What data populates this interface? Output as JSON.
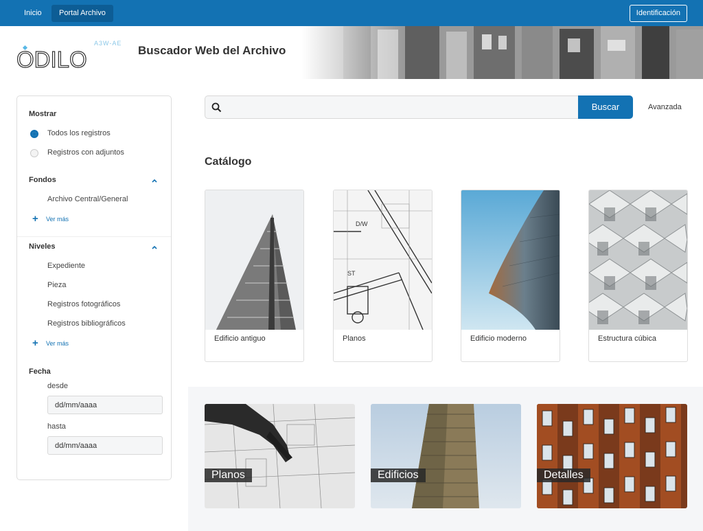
{
  "topnav": {
    "links": [
      {
        "label": "Inicio"
      },
      {
        "label": "Portal Archivo"
      }
    ],
    "login_label": "Identificación"
  },
  "header": {
    "logo_text": "ODILO",
    "logo_sub": "A3W-AE",
    "title": "Buscador Web del Archivo"
  },
  "sidebar": {
    "mostrar": {
      "heading": "Mostrar",
      "options": [
        {
          "label": "Todos los registros",
          "selected": true
        },
        {
          "label": "Registros con adjuntos",
          "selected": false
        }
      ]
    },
    "fondos": {
      "heading": "Fondos",
      "items": [
        {
          "label": "Archivo Central/General"
        }
      ],
      "more": "Ver más"
    },
    "niveles": {
      "heading": "Niveles",
      "items": [
        {
          "label": "Expediente"
        },
        {
          "label": "Pieza"
        },
        {
          "label": "Registros fotográficos"
        },
        {
          "label": "Registros bibliográficos"
        }
      ],
      "more": "Ver más"
    },
    "fecha": {
      "heading": "Fecha",
      "desde_label": "desde",
      "desde_value": "dd/mm/aaaa",
      "hasta_label": "hasta",
      "hasta_value": "dd/mm/aaaa"
    }
  },
  "search": {
    "placeholder": "",
    "button": "Buscar",
    "advanced": "Avanzada"
  },
  "catalog": {
    "title": "Catálogo",
    "cards": [
      {
        "label": "Edificio antiguo"
      },
      {
        "label": "Planos"
      },
      {
        "label": "Edificio moderno"
      },
      {
        "label": "Estructura cúbica"
      }
    ]
  },
  "tiles": [
    {
      "label": "Planos"
    },
    {
      "label": "Edificios"
    },
    {
      "label": "Detalles"
    }
  ],
  "colors": {
    "primary": "#1372b3",
    "primary_dark": "#0d5d95",
    "band": "#f5f6f8"
  }
}
